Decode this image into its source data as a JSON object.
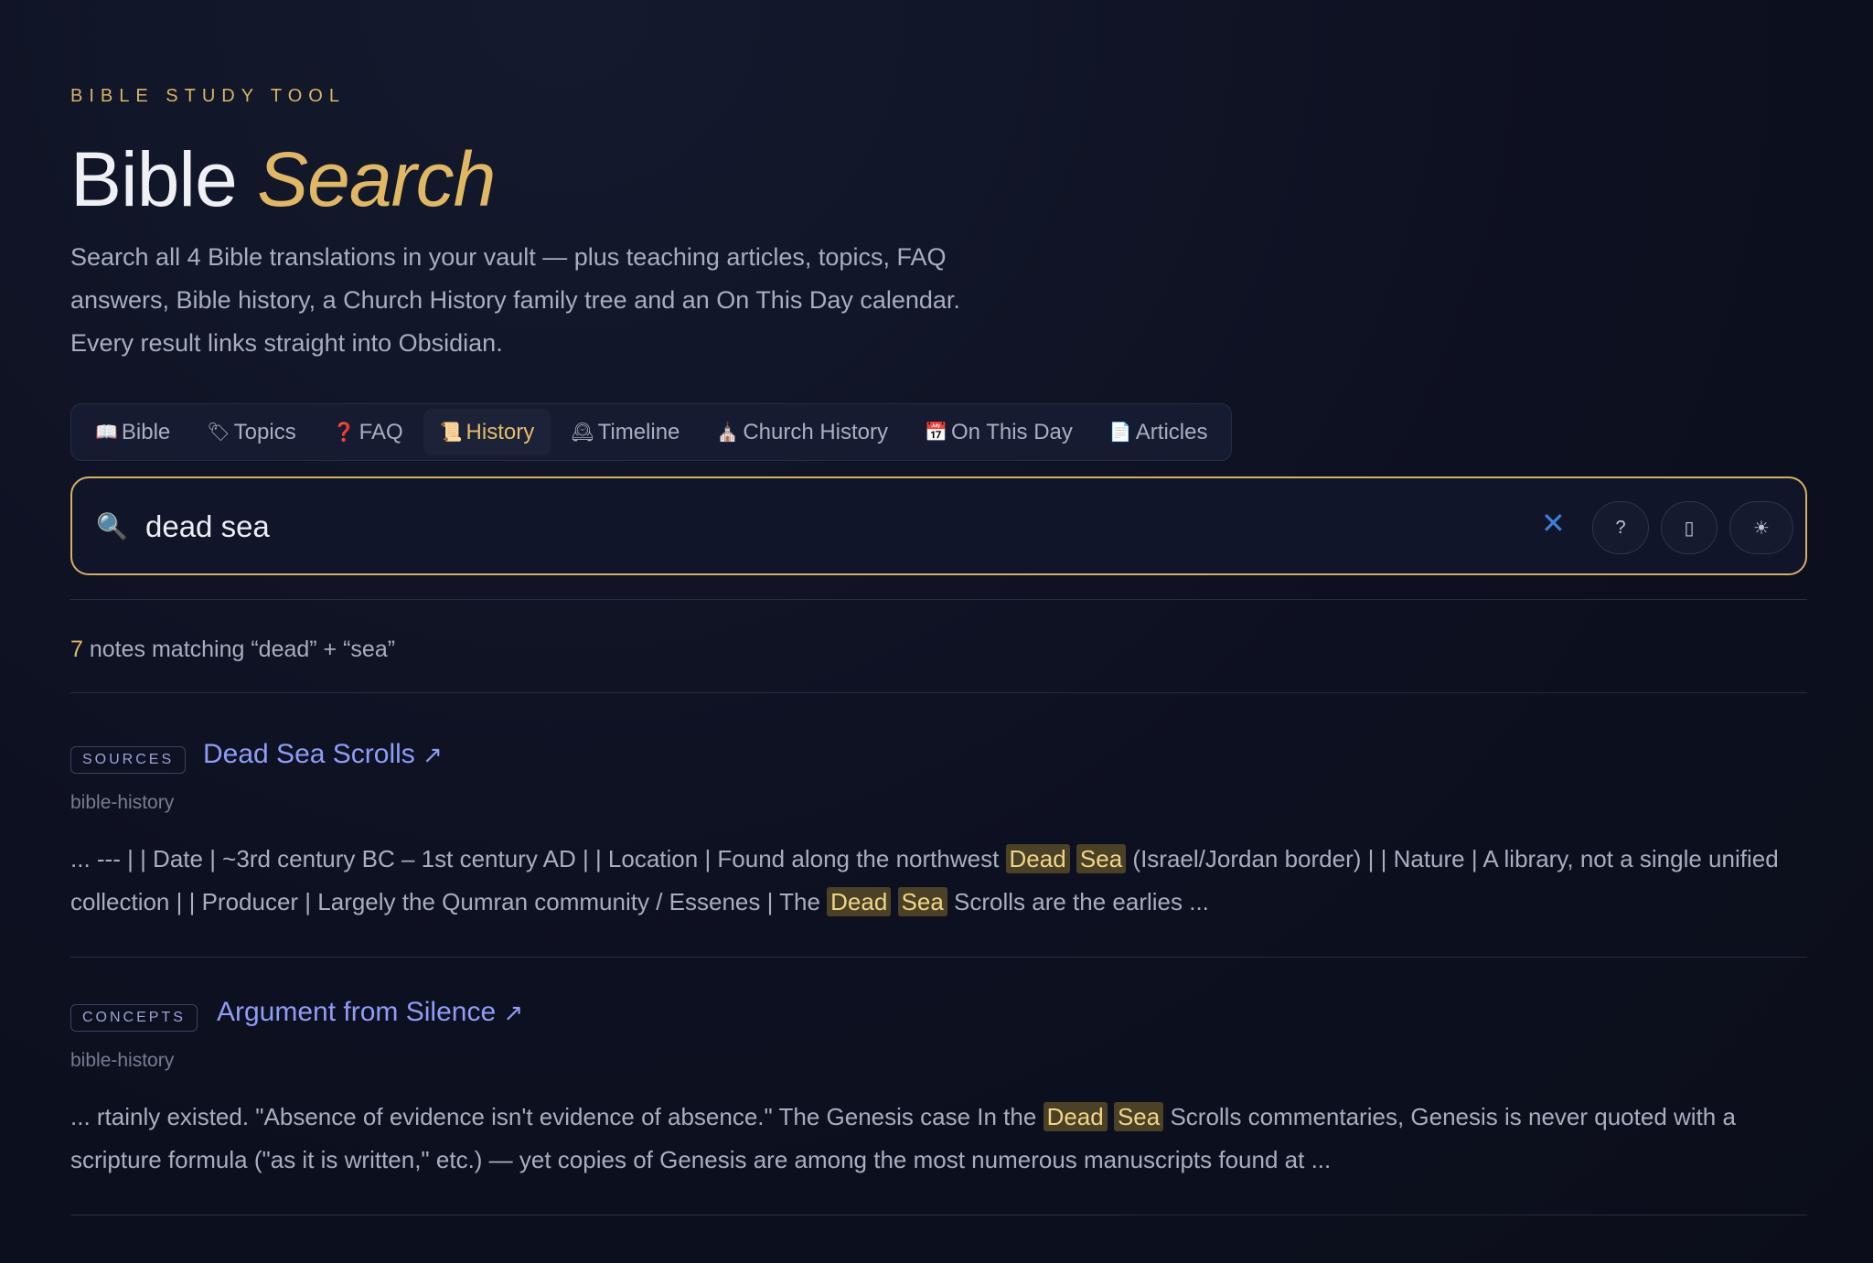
{
  "header": {
    "eyebrow": "BIBLE STUDY TOOL",
    "title_main": "Bible",
    "title_accent": "Search",
    "description": "Search all 4 Bible translations in your vault — plus teaching articles, topics, FAQ answers, Bible history, a Church History family tree and an On This Day calendar. Every result links straight into Obsidian."
  },
  "tabs": [
    {
      "label": "Bible",
      "icon": "open-book-icon",
      "glyph": "📖",
      "active": false
    },
    {
      "label": "Topics",
      "icon": "tag-icon",
      "glyph": "🏷",
      "active": false
    },
    {
      "label": "FAQ",
      "icon": "question-mark-icon",
      "glyph": "❓",
      "active": false
    },
    {
      "label": "History",
      "icon": "scroll-icon",
      "glyph": "📜",
      "active": true
    },
    {
      "label": "Timeline",
      "icon": "clock-icon",
      "glyph": "🕰",
      "active": false
    },
    {
      "label": "Church History",
      "icon": "church-icon",
      "glyph": "⛪",
      "active": false
    },
    {
      "label": "On This Day",
      "icon": "calendar-icon",
      "glyph": "📅",
      "active": false
    },
    {
      "label": "Articles",
      "icon": "document-icon",
      "glyph": "📄",
      "active": false
    }
  ],
  "search": {
    "value": "dead sea",
    "clear_glyph": "✕",
    "help_glyph": "?",
    "mode_glyph": "▯",
    "theme_glyph": "☀"
  },
  "results_summary": {
    "count": "7",
    "text": "notes matching “dead” + “sea”"
  },
  "results": [
    {
      "badge": "SOURCES",
      "title": "Dead Sea Scrolls",
      "arrow": "↗",
      "path": "bible-history",
      "snippet": [
        {
          "t": "... --- | | Date | ~3rd century BC – 1st century AD | | Location | Found along the northwest ",
          "h": false
        },
        {
          "t": "Dead",
          "h": true
        },
        {
          "t": " ",
          "h": false
        },
        {
          "t": "Sea",
          "h": true
        },
        {
          "t": " (Israel/Jordan border) | | Nature | A library, not a single unified collection | | Producer | Largely the Qumran community / Essenes | The ",
          "h": false
        },
        {
          "t": "Dead",
          "h": true
        },
        {
          "t": " ",
          "h": false
        },
        {
          "t": "Sea",
          "h": true
        },
        {
          "t": " Scrolls are the earlies ...",
          "h": false
        }
      ]
    },
    {
      "badge": "CONCEPTS",
      "title": "Argument from Silence",
      "arrow": "↗",
      "path": "bible-history",
      "snippet": [
        {
          "t": "... rtainly existed. \"Absence of evidence isn't evidence of absence.\" The Genesis case In the ",
          "h": false
        },
        {
          "t": "Dead",
          "h": true
        },
        {
          "t": " ",
          "h": false
        },
        {
          "t": "Sea",
          "h": true
        },
        {
          "t": " Scrolls commentaries, Genesis is never quoted with a scripture formula (\"as it is written,\" etc.) — yet copies of Genesis are among the most numerous manuscripts found at ...",
          "h": false
        }
      ]
    }
  ]
}
